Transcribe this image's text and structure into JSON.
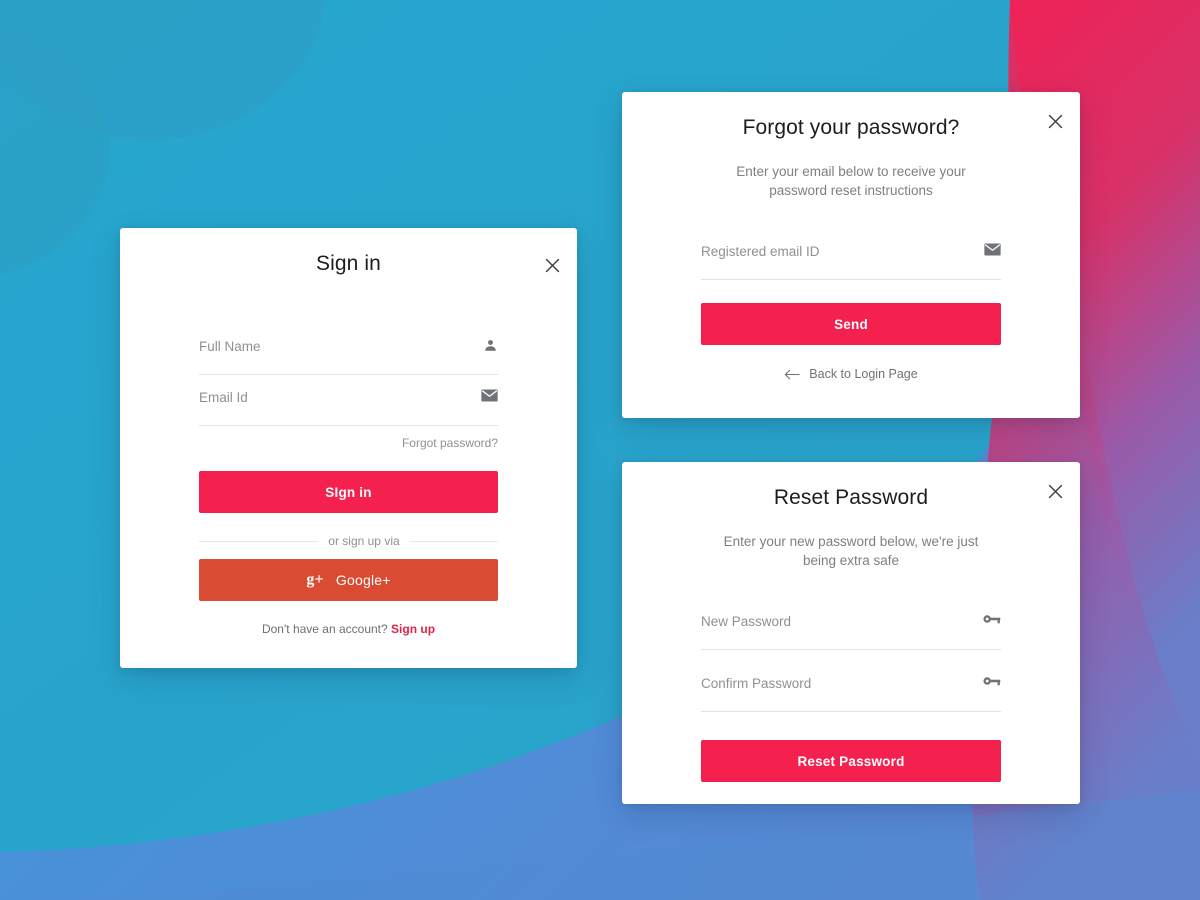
{
  "background": {
    "base_color": "#29a3cc",
    "cyan": "#2aa5cd",
    "blue": "#4a90d9",
    "crimson": "#e8285c",
    "purple": "#8a5fb0",
    "blob_shade": "#2e9cc0"
  },
  "theme": {
    "primary_red": "#f4204d",
    "google_orange": "#da4b33",
    "accent_link": "#e0224a",
    "muted_text": "#8d9195",
    "title_text": "#1d1d1d",
    "field_underline": "#e2e4e6"
  },
  "signin_card": {
    "title": "Sign in",
    "close_icon": "close-icon",
    "fields": [
      {
        "label": "Full Name",
        "icon": "person-icon"
      },
      {
        "label": "Email Id",
        "icon": "envelope-icon"
      }
    ],
    "forgot_link": "Forgot password?",
    "submit_label": "SIgn in",
    "divider_text": "or sign up via",
    "google_label": "Google+",
    "google_glyph": "g+",
    "footer_text": "Don't have an account?",
    "footer_link": "Sign up"
  },
  "forgot_card": {
    "title": "Forgot your password?",
    "close_icon": "close-icon",
    "subtitle": "Enter your email below to receive your password reset instructions",
    "field": {
      "label": "Registered email ID",
      "icon": "envelope-icon"
    },
    "submit_label": "Send",
    "back_link": "Back to Login Page",
    "back_icon": "arrow-left-icon"
  },
  "reset_card": {
    "title": "Reset Password",
    "close_icon": "close-icon",
    "subtitle": "Enter your new password below, we're just being extra safe",
    "fields": [
      {
        "label": "New Password",
        "icon": "key-icon"
      },
      {
        "label": "Confirm Password",
        "icon": "key-icon"
      }
    ],
    "submit_label": "Reset Password"
  }
}
